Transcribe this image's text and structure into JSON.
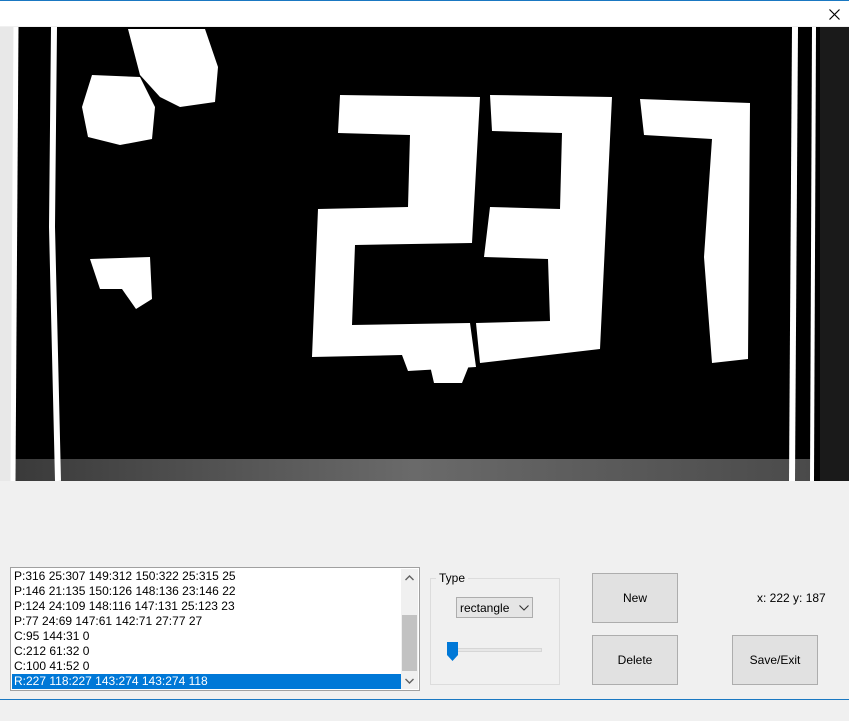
{
  "window": {
    "close_icon": "close-icon"
  },
  "canvas": {
    "description_text": "237"
  },
  "shapes_list": {
    "items": [
      "P:316 25:307 149:312 150:322 25:315 25",
      "P:146 21:135 150:126 148:136 23:146 22",
      "P:124 24:109 148:116 147:131 25:123 23",
      "P:77 24:69 147:61 142:71 27:77 27",
      "C:95 144:31 0",
      "C:212 61:32 0",
      "C:100 41:52 0",
      "R:227 118:227 143:274 143:274 118"
    ],
    "selected_index": 7
  },
  "type_group": {
    "label": "Type",
    "selected": "rectangle",
    "slider_value": 0.0
  },
  "buttons": {
    "new_label": "New",
    "delete_label": "Delete",
    "save_exit_label": "Save/Exit"
  },
  "status": {
    "coords": "x: 222 y: 187"
  },
  "colors": {
    "accent": "#0078d7",
    "window_border": "#1a78c2",
    "background": "#f0f0f0"
  }
}
